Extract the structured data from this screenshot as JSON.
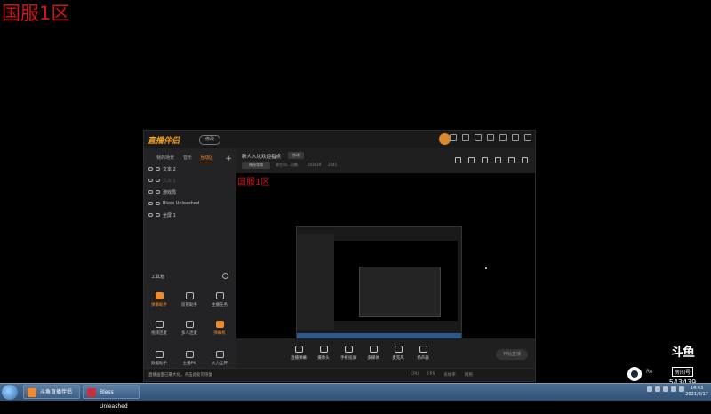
{
  "overlay": {
    "title": "国服1区"
  },
  "app": {
    "logo_text": "直播伴侣",
    "badge": "修改",
    "left_tabs": [
      "我的场景",
      "音乐",
      "互动区"
    ],
    "active_tab_index": 2,
    "plus": "+",
    "scenes": [
      {
        "label": "文本 2",
        "dim": false
      },
      {
        "label": "文本 1",
        "dim": true
      },
      {
        "label": "游戏局",
        "dim": false
      },
      {
        "label": "Bless Unleashed",
        "dim": false
      },
      {
        "label": "全屏 1",
        "dim": false
      }
    ],
    "tools_label": "工具箱",
    "tools": [
      {
        "label": "弹幕助手",
        "orange": true
      },
      {
        "label": "房管助手",
        "orange": false
      },
      {
        "label": "主播任务",
        "orange": false
      },
      {
        "label": "视频连麦",
        "orange": false
      },
      {
        "label": "多人连麦",
        "orange": false
      },
      {
        "label": "弹幕机",
        "orange": true
      },
      {
        "label": "数据助手",
        "orange": false
      },
      {
        "label": "主播PK",
        "orange": false
      },
      {
        "label": "火力全开",
        "orange": false
      }
    ],
    "room": {
      "title": "新人入坑欢迎指点",
      "edit": "修改",
      "tag": "神秘领域",
      "meta": "原生dn...司钢",
      "id": "543439",
      "fans": "2141"
    },
    "preview_title": "国服1区",
    "bottom_items": [
      "直播弹幕",
      "摄像头",
      "手机投屏",
      "多媒体",
      "麦克风",
      "扬声器"
    ],
    "start_button": "开始直播",
    "status_warning": "直播画面已最大化，点击此处可恢复",
    "status_stats": [
      "CPU",
      "FPS",
      "丢帧率",
      "网络"
    ]
  },
  "taskbar": {
    "buttons": [
      {
        "label": "斗鱼直播伴侣",
        "color": "#f08a2a"
      },
      {
        "label": "Bless Unleashed",
        "color": "#c8303a"
      }
    ],
    "time": "14:43",
    "date": "2021/8/17"
  },
  "watermark": {
    "logo": "斗鱼",
    "box": "房间号",
    "room_id": "543439",
    "steam_text": "Re"
  }
}
